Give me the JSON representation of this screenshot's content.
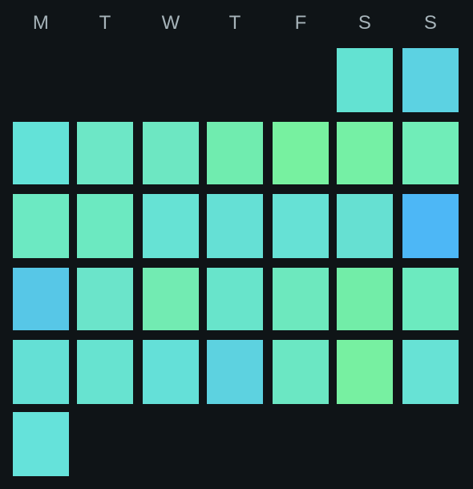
{
  "weekdays": [
    "M",
    "T",
    "W",
    "T",
    "F",
    "S",
    "S"
  ],
  "weeks": [
    [
      null,
      null,
      null,
      null,
      null,
      "#63e2d2",
      "#5cd2e2"
    ],
    [
      "#63e2d8",
      "#6de7c6",
      "#6de7c2",
      "#70ecaf",
      "#77f1a0",
      "#75f0a5",
      "#70edb8"
    ],
    [
      "#6ce9c2",
      "#6ce9c1",
      "#66e2d4",
      "#65e0d5",
      "#66e1d5",
      "#66e0d2",
      "#4db7f6"
    ],
    [
      "#57c7e7",
      "#6be4ca",
      "#72ebb2",
      "#68e4cb",
      "#6de8be",
      "#72eda8",
      "#6ceabf"
    ],
    [
      "#64e0d5",
      "#67e3d0",
      "#64e0d8",
      "#5dd2e0",
      "#6be7c3",
      "#77f0a1",
      "#67e2d5"
    ],
    [
      "#65e2da",
      null,
      null,
      null,
      null,
      null,
      null
    ]
  ]
}
